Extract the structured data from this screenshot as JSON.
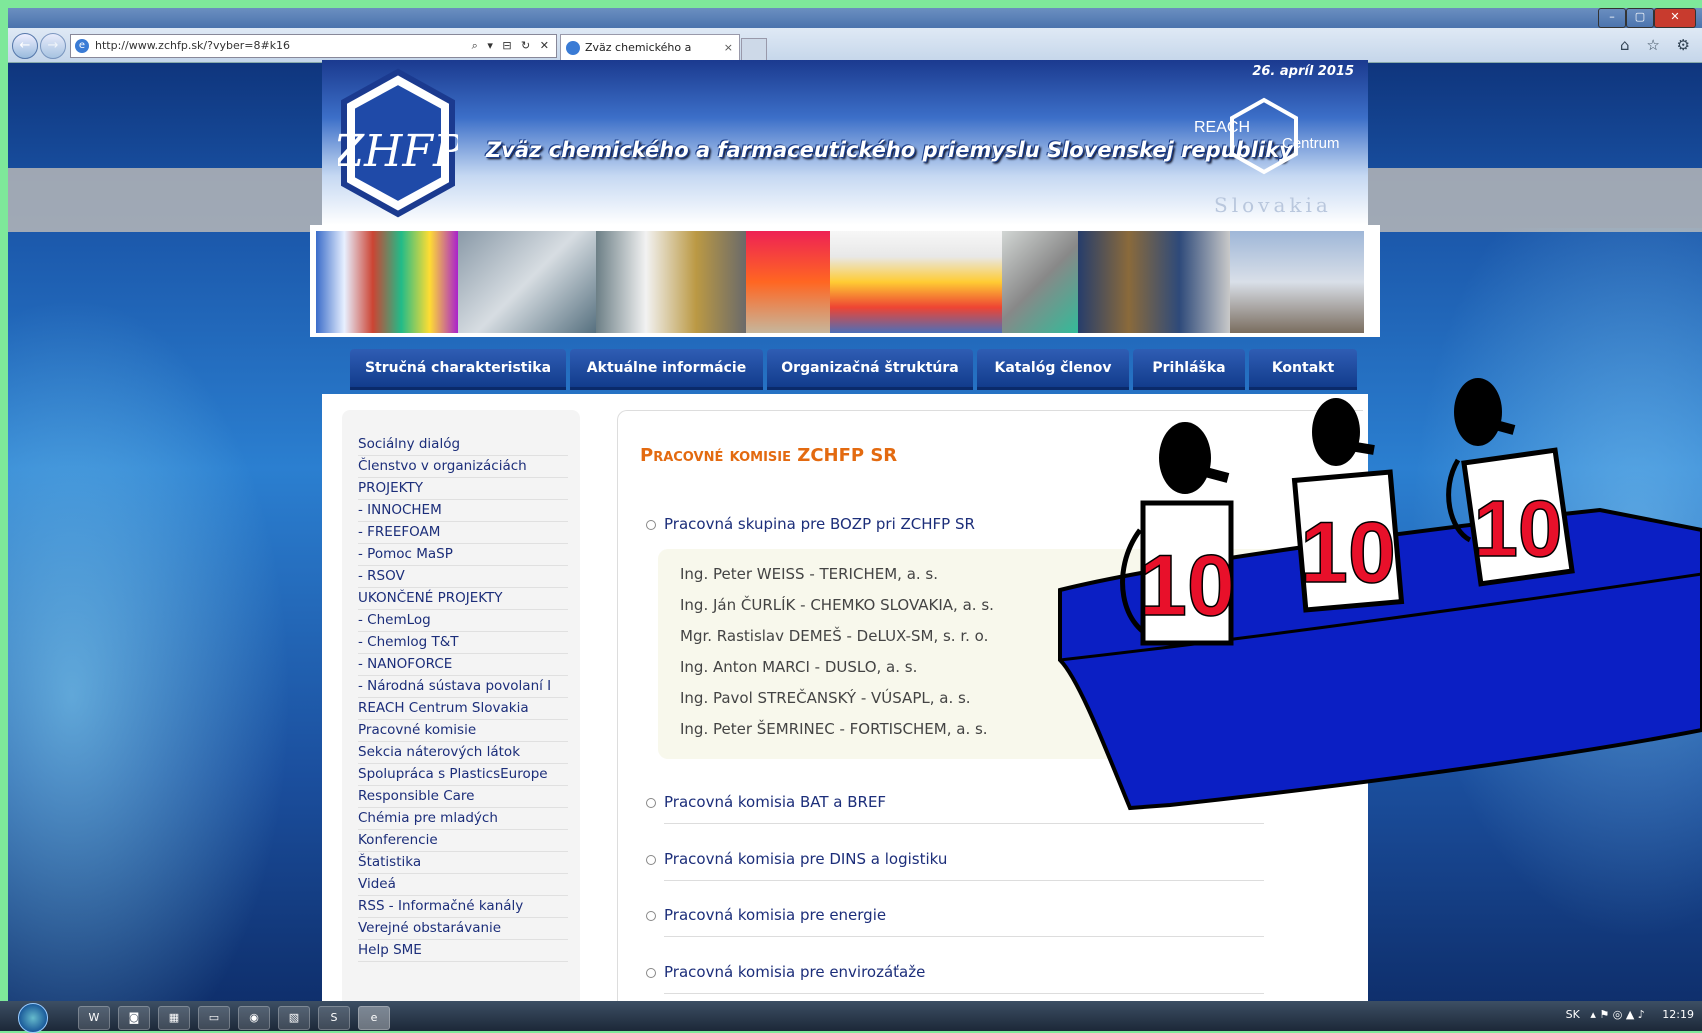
{
  "browser": {
    "url": "http://www.zchfp.sk/?vyber=8#k16",
    "tab_title": "Zväz chemického a farmac...",
    "tab_close": "×",
    "addr_tools": "⌕ ▾ ⊟ ↻ ✕",
    "win_min": "–",
    "win_max": "▢",
    "win_close": "✕",
    "back": "←",
    "forward": "→",
    "right_icons": "⌂ ☆ ⚙"
  },
  "site": {
    "date": "26. apríl 2015",
    "logo_text": "ZHFP",
    "org_name": "Zväz chemického a farmaceutického priemyslu Slovenskej republiky",
    "reach_line1": "REACH",
    "reach_line2": "Centrum",
    "reach_line3": "Slovakia"
  },
  "menu": [
    {
      "label": "Stručná charakteristika"
    },
    {
      "label": "Aktuálne informácie"
    },
    {
      "label": "Organizačná štruktúra"
    },
    {
      "label": "Katalóg členov"
    },
    {
      "label": "Prihláška"
    },
    {
      "label": "Kontakt"
    }
  ],
  "sidebar": [
    "Sociálny dialóg",
    "Členstvo v organizáciách",
    "PROJEKTY",
    "- INNOCHEM",
    "- FREEFOAM",
    "- Pomoc MaSP",
    "- RSOV",
    "UKONČENÉ PROJEKTY",
    "- ChemLog",
    "- Chemlog T&T",
    "- NANOFORCE",
    "- Národná sústava povolaní I",
    "REACH Centrum Slovakia",
    "Pracovné komisie",
    "Sekcia náterových látok",
    "Spolupráca s PlasticsEurope",
    "Responsible Care",
    "Chémia pre mladých",
    "Konferencie",
    "Štatistika",
    "Videá",
    "RSS - Informačné kanály",
    "Verejné obstarávanie",
    "Help SME"
  ],
  "main": {
    "title_prefix": "Pracovné komisie ",
    "title_bold": "ZCHFP SR",
    "groups": [
      "Pracovná skupina pre BOZP pri ZCHFP SR",
      "Pracovná komisia BAT a BREF",
      "Pracovná komisia pre DINS a logistiku",
      "Pracovná komisia pre energie",
      "Pracovná komisia pre envirozáťaže"
    ],
    "members": [
      "Ing. Peter WEISS - TERICHEM, a. s.",
      "Ing. Ján ČURLÍK - CHEMKO SLOVAKIA, a. s.",
      "Mgr. Rastislav DEMEŠ - DeLUX-SM, s. r. o.",
      "Ing. Anton MARCI - DUSLO, a. s.",
      "Ing. Pavol STREČANSKÝ - VÚSAPL, a. s.",
      "Ing. Peter ŠEMRINEC - FORTISCHEM, a. s."
    ]
  },
  "cartoon": {
    "scores": [
      "10",
      "10",
      "10"
    ]
  },
  "taskbar": {
    "apps": [
      "W",
      "◙",
      "▦",
      "▭",
      "◉",
      "▧",
      "S",
      "e"
    ],
    "lang": "SK",
    "tray_icons": "▴ ⚑ ◎ ▲ ♪",
    "time": "12:19"
  }
}
